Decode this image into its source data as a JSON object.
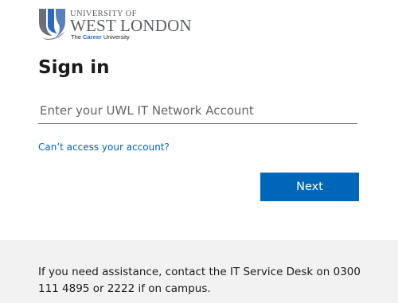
{
  "logo": {
    "line1": "UNIVERSITY OF",
    "line2": "WEST LONDON",
    "tagline_prefix": "The ",
    "tagline_accent": "Career",
    "tagline_suffix": " University",
    "icon": "uwl-shield-logo-icon"
  },
  "signin": {
    "title": "Sign in",
    "account_placeholder": "Enter your UWL IT Network Account",
    "account_value": "",
    "cant_access_link": "Can’t access your account?",
    "next_button": "Next"
  },
  "footer": {
    "help_text": "If you need assistance, contact the IT Service Desk on 0300 111 4895 or 2222 if on campus."
  },
  "colors": {
    "accent": "#0067b8",
    "footer_bg": "#f2f2f2",
    "logo_grey": "#5a5e63",
    "logo_blue": "#2a6bc1"
  }
}
